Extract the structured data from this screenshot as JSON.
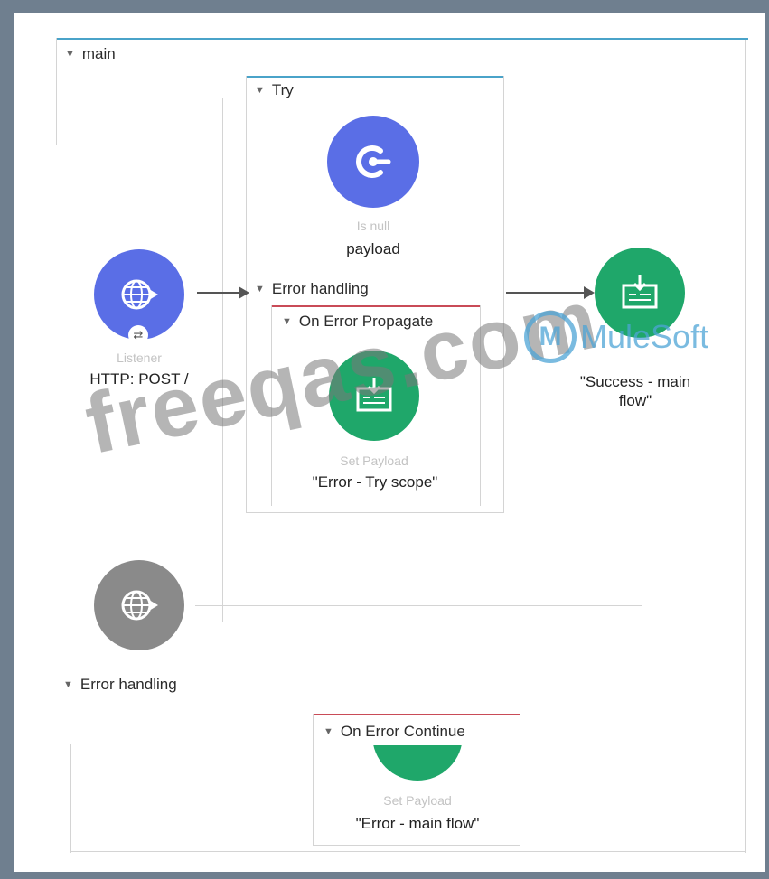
{
  "flow": {
    "title": "main",
    "try_scope": {
      "title": "Try",
      "component": {
        "type_label": "Is null",
        "text": "payload"
      },
      "error_handling": {
        "title": "Error handling",
        "handler": {
          "title": "On Error Propagate",
          "component": {
            "type_label": "Set Payload",
            "text": "\"Error - Try scope\""
          }
        }
      }
    },
    "source": {
      "type_label": "Listener",
      "text": "HTTP: POST /"
    },
    "success": {
      "text": "\"Success - main flow\""
    },
    "error_handling": {
      "title": "Error handling",
      "handler": {
        "title": "On Error Continue",
        "component": {
          "type_label": "Set Payload",
          "text": "\"Error - main flow\""
        }
      }
    }
  },
  "watermarks": {
    "site": "freeqas.com",
    "brand": "MuleSoft",
    "brand_mark": "M"
  },
  "colors": {
    "processor": "#5a6ee6",
    "set_payload": "#1fa76a",
    "inactive": "#8a8a8a",
    "scope_line": "#4aa3c9",
    "error_line": "#c94b57"
  },
  "icons": [
    "is-null-icon",
    "http-listener-icon",
    "set-payload-icon",
    "http-listener-response-icon",
    "expand-triangle-icon"
  ]
}
